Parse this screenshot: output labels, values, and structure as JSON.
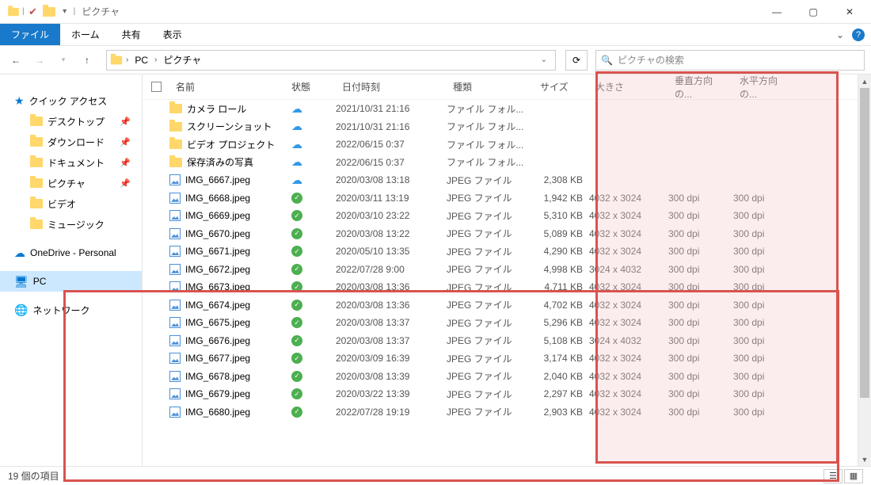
{
  "window": {
    "title": "ピクチャ"
  },
  "ribbon": {
    "file": "ファイル",
    "home": "ホーム",
    "share": "共有",
    "view": "表示"
  },
  "breadcrumbs": [
    "PC",
    "ピクチャ"
  ],
  "search": {
    "placeholder": "ピクチャの検索"
  },
  "sidebar": {
    "quick_access": "クイック アクセス",
    "desktop": "デスクトップ",
    "downloads": "ダウンロード",
    "documents": "ドキュメント",
    "pictures": "ピクチャ",
    "videos": "ビデオ",
    "music": "ミュージック",
    "onedrive": "OneDrive - Personal",
    "pc": "PC",
    "network": "ネットワーク"
  },
  "columns": {
    "name": "名前",
    "status": "状態",
    "date": "日付時刻",
    "type": "種類",
    "size": "サイズ",
    "dim": "大きさ",
    "vdpi": "垂直方向の...",
    "hdpi": "水平方向の..."
  },
  "rows": [
    {
      "icon": "folder",
      "name": "カメラ ロール",
      "status": "cloud",
      "date": "2021/10/31 21:16",
      "type": "ファイル フォル...",
      "size": "",
      "dim": "",
      "vdpi": "",
      "hdpi": ""
    },
    {
      "icon": "folder",
      "name": "スクリーンショット",
      "status": "cloud",
      "date": "2021/10/31 21:16",
      "type": "ファイル フォル...",
      "size": "",
      "dim": "",
      "vdpi": "",
      "hdpi": ""
    },
    {
      "icon": "folder",
      "name": "ビデオ プロジェクト",
      "status": "cloud",
      "date": "2022/06/15 0:37",
      "type": "ファイル フォル...",
      "size": "",
      "dim": "",
      "vdpi": "",
      "hdpi": ""
    },
    {
      "icon": "folder",
      "name": "保存済みの写真",
      "status": "cloud",
      "date": "2022/06/15 0:37",
      "type": "ファイル フォル...",
      "size": "",
      "dim": "",
      "vdpi": "",
      "hdpi": ""
    },
    {
      "icon": "img",
      "name": "IMG_6667.jpeg",
      "status": "cloud",
      "date": "2020/03/08 13:18",
      "type": "JPEG ファイル",
      "size": "2,308 KB",
      "dim": "",
      "vdpi": "",
      "hdpi": ""
    },
    {
      "icon": "img",
      "name": "IMG_6668.jpeg",
      "status": "sync",
      "date": "2020/03/11 13:19",
      "type": "JPEG ファイル",
      "size": "1,942 KB",
      "dim": "4032 x 3024",
      "vdpi": "300 dpi",
      "hdpi": "300 dpi"
    },
    {
      "icon": "img",
      "name": "IMG_6669.jpeg",
      "status": "sync",
      "date": "2020/03/10 23:22",
      "type": "JPEG ファイル",
      "size": "5,310 KB",
      "dim": "4032 x 3024",
      "vdpi": "300 dpi",
      "hdpi": "300 dpi"
    },
    {
      "icon": "img",
      "name": "IMG_6670.jpeg",
      "status": "sync",
      "date": "2020/03/08 13:22",
      "type": "JPEG ファイル",
      "size": "5,089 KB",
      "dim": "4032 x 3024",
      "vdpi": "300 dpi",
      "hdpi": "300 dpi"
    },
    {
      "icon": "img",
      "name": "IMG_6671.jpeg",
      "status": "sync",
      "date": "2020/05/10 13:35",
      "type": "JPEG ファイル",
      "size": "4,290 KB",
      "dim": "4032 x 3024",
      "vdpi": "300 dpi",
      "hdpi": "300 dpi"
    },
    {
      "icon": "img",
      "name": "IMG_6672.jpeg",
      "status": "sync",
      "date": "2022/07/28 9:00",
      "type": "JPEG ファイル",
      "size": "4,998 KB",
      "dim": "3024 x 4032",
      "vdpi": "300 dpi",
      "hdpi": "300 dpi"
    },
    {
      "icon": "img",
      "name": "IMG_6673.jpeg",
      "status": "sync",
      "date": "2020/03/08 13:36",
      "type": "JPEG ファイル",
      "size": "4,711 KB",
      "dim": "4032 x 3024",
      "vdpi": "300 dpi",
      "hdpi": "300 dpi"
    },
    {
      "icon": "img",
      "name": "IMG_6674.jpeg",
      "status": "sync",
      "date": "2020/03/08 13:36",
      "type": "JPEG ファイル",
      "size": "4,702 KB",
      "dim": "4032 x 3024",
      "vdpi": "300 dpi",
      "hdpi": "300 dpi"
    },
    {
      "icon": "img",
      "name": "IMG_6675.jpeg",
      "status": "sync",
      "date": "2020/03/08 13:37",
      "type": "JPEG ファイル",
      "size": "5,296 KB",
      "dim": "4032 x 3024",
      "vdpi": "300 dpi",
      "hdpi": "300 dpi"
    },
    {
      "icon": "img",
      "name": "IMG_6676.jpeg",
      "status": "sync",
      "date": "2020/03/08 13:37",
      "type": "JPEG ファイル",
      "size": "5,108 KB",
      "dim": "3024 x 4032",
      "vdpi": "300 dpi",
      "hdpi": "300 dpi"
    },
    {
      "icon": "img",
      "name": "IMG_6677.jpeg",
      "status": "sync",
      "date": "2020/03/09 16:39",
      "type": "JPEG ファイル",
      "size": "3,174 KB",
      "dim": "4032 x 3024",
      "vdpi": "300 dpi",
      "hdpi": "300 dpi"
    },
    {
      "icon": "img",
      "name": "IMG_6678.jpeg",
      "status": "sync",
      "date": "2020/03/08 13:39",
      "type": "JPEG ファイル",
      "size": "2,040 KB",
      "dim": "4032 x 3024",
      "vdpi": "300 dpi",
      "hdpi": "300 dpi"
    },
    {
      "icon": "img",
      "name": "IMG_6679.jpeg",
      "status": "sync",
      "date": "2020/03/22 13:39",
      "type": "JPEG ファイル",
      "size": "2,297 KB",
      "dim": "4032 x 3024",
      "vdpi": "300 dpi",
      "hdpi": "300 dpi"
    },
    {
      "icon": "img",
      "name": "IMG_6680.jpeg",
      "status": "sync",
      "date": "2022/07/28 19:19",
      "type": "JPEG ファイル",
      "size": "2,903 KB",
      "dim": "4032 x 3024",
      "vdpi": "300 dpi",
      "hdpi": "300 dpi"
    }
  ],
  "status": {
    "items": "19 個の項目"
  }
}
